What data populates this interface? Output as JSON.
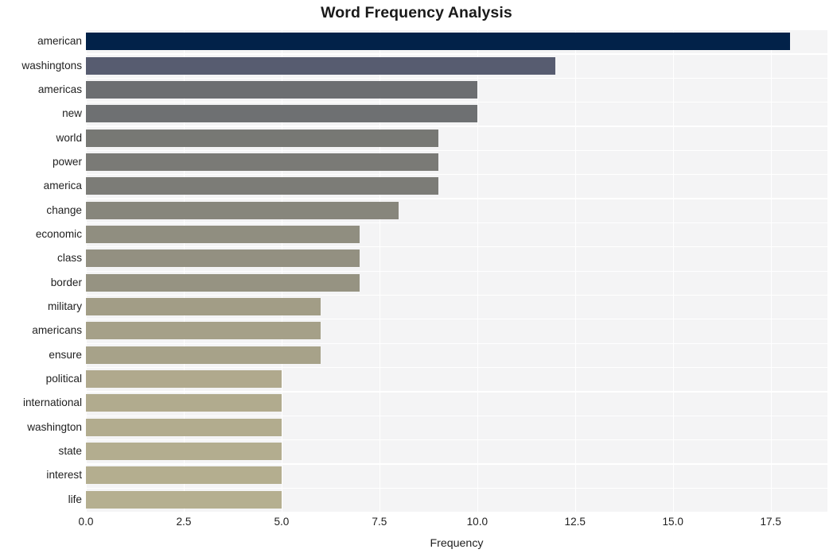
{
  "chart_data": {
    "type": "bar",
    "orientation": "horizontal",
    "title": "Word Frequency Analysis",
    "xlabel": "Frequency",
    "ylabel": "",
    "categories": [
      "american",
      "washingtons",
      "americas",
      "new",
      "world",
      "power",
      "america",
      "change",
      "economic",
      "class",
      "border",
      "military",
      "americans",
      "ensure",
      "political",
      "international",
      "washington",
      "state",
      "interest",
      "life"
    ],
    "values": [
      18,
      12,
      10,
      10,
      9,
      9,
      9,
      8,
      7,
      7,
      7,
      6,
      6,
      6,
      5,
      5,
      5,
      5,
      5,
      5
    ],
    "xlim": [
      0,
      18.95
    ],
    "xticks": [
      0.0,
      2.5,
      5.0,
      7.5,
      10.0,
      12.5,
      15.0,
      17.5
    ],
    "xtick_labels": [
      "0.0",
      "2.5",
      "5.0",
      "7.5",
      "10.0",
      "12.5",
      "15.0",
      "17.5"
    ],
    "grid": true,
    "grid_color": "#ffffff",
    "legend": null,
    "plot_background": "#f4f4f5",
    "figure_background": "#ffffff",
    "colormap": "cividis_r",
    "bar_colors": [
      "#022249",
      "#575c70",
      "#6c6e71",
      "#6e7072",
      "#777874",
      "#7a7a76",
      "#7c7c77",
      "#87867c",
      "#908e80",
      "#939081",
      "#969382",
      "#a29d86",
      "#a5a088",
      "#a7a289",
      "#b0a98d",
      "#b1ab8e",
      "#b2ac8e",
      "#b3ad8f",
      "#b4ae8f",
      "#b5af90"
    ]
  }
}
